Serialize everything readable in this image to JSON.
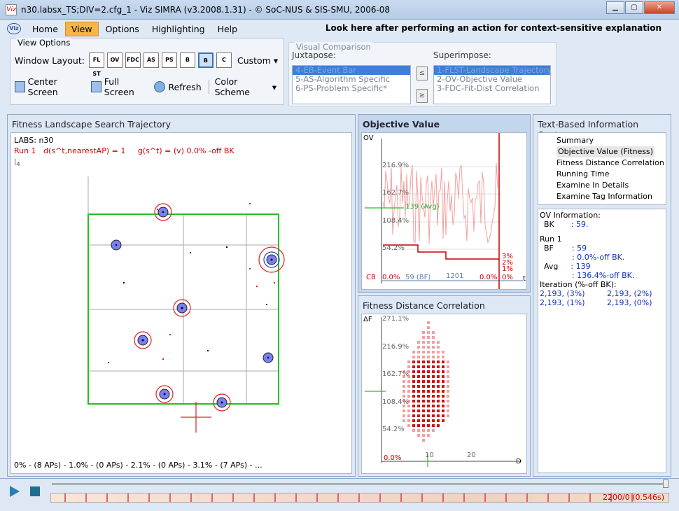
{
  "window": {
    "title": "n30.labsx_TS;DIV=2.cfg_1 - Viz SIMRA (v3.2008.1.31) - © SoC-NUS & SIS-SMU, 2006-08",
    "icon_text": "Viz"
  },
  "menu": {
    "items": [
      "Home",
      "View",
      "Options",
      "Highlighting",
      "Help"
    ],
    "active": "View",
    "hint": "Look here after performing an action for context-sensitive explanation"
  },
  "view_options": {
    "caption": "View Options",
    "window_layout_label": "Window Layout:",
    "layout_buttons": [
      "FL ST",
      "OV",
      "FDC",
      "AS",
      "PS",
      "B",
      "B",
      "C"
    ],
    "custom_label": "Custom",
    "center": "Center Screen",
    "full": "Full Screen",
    "refresh": "Refresh",
    "color_scheme": "Color Scheme"
  },
  "visual_comparison": {
    "caption": "Visual Comparison",
    "juxtapose_label": "Juxtapose:",
    "superimpose_label": "Superimpose:",
    "juxtapose_items": [
      "4-EB-Event Bar",
      "5-AS-Algorithm Specific",
      "6-PS-Problem Specific*"
    ],
    "superimpose_items": [
      "1-FLST-Landscape Trajectory",
      "2-OV-Objective Value",
      "3-FDC-Fit-Dist Correlation"
    ],
    "left_arrow": "≤",
    "right_arrow": "≥"
  },
  "fitness_landscape": {
    "title": "Fitness Landscape Search Trajectory",
    "problem": "LABS: n30",
    "run_line": "Run 1   d(s^t,nearestAP) = 1     g(s^t) = (v) 0.0% -off BK",
    "tick_label": "4",
    "footer": "0% - (8 APs) - 1.0% - (0 APs) - 2.1% - (0 APs) - 3.1% - (7 APs) - ..."
  },
  "objective_value": {
    "title": "Objective Value",
    "y_axis": "OV",
    "x_axis": "t",
    "ticks": [
      "216.9%",
      "162.7%",
      "108.4%",
      "54.2%"
    ],
    "avg_label": "139 (Avg)",
    "cb_label": "CB",
    "cb_pct": "0.0%",
    "bf_label": "59 (BF)",
    "x_mark": "1201",
    "end_pct": "0.0%",
    "right_pct": "0%",
    "side_labels": [
      "3%",
      "2%",
      "1%"
    ]
  },
  "fdc": {
    "title": "Fitness Distance Correlation",
    "y_axis": "ΔF",
    "x_axis": "D",
    "ticks": [
      "271.1%",
      "216.9%",
      "162.7%",
      "108.4%",
      "54.2%"
    ],
    "zero_label": "0.0%",
    "x_ticks": [
      "10",
      "20"
    ]
  },
  "text_info": {
    "title": "Text-Based Information Center",
    "nav": [
      "Summary",
      "Objective Value (Fitness)",
      "Fitness Distance Correlation",
      "Running Time",
      "Examine In Details",
      "Examine Tag Information"
    ],
    "nav_selected": 1,
    "ov_info_label": "OV Information:",
    "bk_label": "BK",
    "bk_value": ": 59.",
    "run_label": "Run 1",
    "bf_label": "BF",
    "bf_value": ": 59",
    "bf_off": ": 0.0%-off BK.",
    "avg_label": "Avg",
    "avg_value": ": 139",
    "avg_off": ": 136.4%-off BK.",
    "iter_label": "Iteration (%-off BK):",
    "iter_rows": [
      [
        "2,193,  (3%)",
        "2,193,  (2%)"
      ],
      [
        "2,193,  (1%)",
        "2,193,  (0%)"
      ]
    ]
  },
  "playback": {
    "status": "2200/0 (0.546s)",
    "progress": 1.0
  },
  "colors": {
    "accent": "#3d7fd9",
    "menu_active": "#f5b548",
    "trajectory_green": "#22c022",
    "fitness_red": "#cc0000",
    "ap_blue": "#7b7ff0"
  }
}
